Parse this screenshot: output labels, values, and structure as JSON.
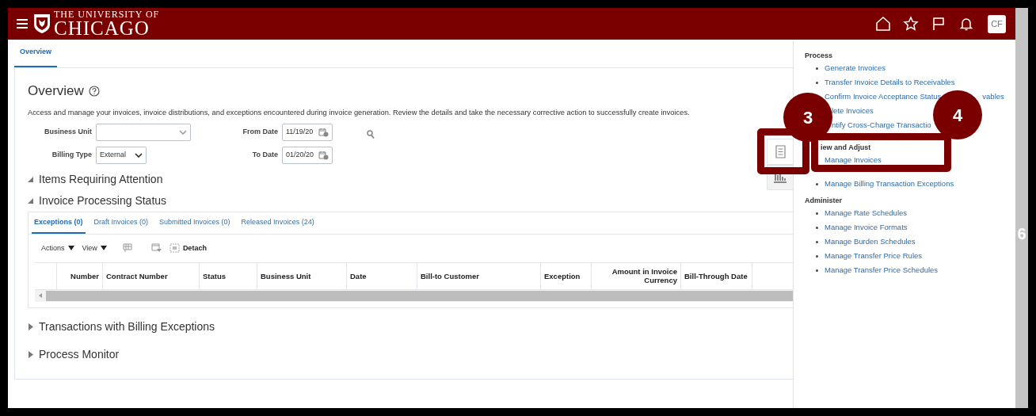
{
  "header": {
    "logo_top": "THE UNIVERSITY OF",
    "logo_main": "CHICAGO",
    "avatar": "CF"
  },
  "tabs": [
    {
      "label": "Overview",
      "selected": true
    }
  ],
  "overview": {
    "title": "Overview",
    "description": "Access and manage your invoices, invoice distributions, and exceptions encountered during invoice generation. Review the details and take the necessary corrective action to successfully create invoices.",
    "fields_left": [
      {
        "label": "Business Unit",
        "kind": "select"
      },
      {
        "label": "Billing Type",
        "kind": "select",
        "value": "External"
      }
    ],
    "fields_right": [
      {
        "label": "From Date",
        "kind": "date",
        "value": "11/19/20"
      },
      {
        "label": "To Date",
        "kind": "date",
        "value": "01/20/20"
      }
    ]
  },
  "sections_top": [
    {
      "title": "Items Requiring Attention",
      "expanded": true
    },
    {
      "title": "Invoice Processing Status",
      "expanded": true
    }
  ],
  "status_tabs": [
    {
      "label": "Exceptions (0)",
      "selected": true
    },
    {
      "label": "Draft Invoices (0)",
      "selected": false
    },
    {
      "label": "Submitted Invoices (0)",
      "selected": false
    },
    {
      "label": "Released Invoices (24)",
      "selected": false
    }
  ],
  "toolbar": {
    "menus": [
      "Actions",
      "View"
    ],
    "detach": "Detach"
  },
  "columns": [
    "Number",
    "Contract Number",
    "Status",
    "Business Unit",
    "Date",
    "Bill-to Customer",
    "Exception",
    "Amount in Invoice Currency",
    "Bill-Through Date"
  ],
  "sections_bottom": [
    {
      "title": "Transactions with Billing Exceptions",
      "expanded": false
    },
    {
      "title": "Process Monitor",
      "expanded": false
    }
  ],
  "tasks": [
    {
      "heading": "Process",
      "kind": "plain",
      "items": [
        {
          "label": "Generate Invoices",
          "kind": "link"
        },
        {
          "label": "Transfer Invoice Details to Receivables",
          "kind": "link"
        },
        {
          "label": "Confirm Invoice Acceptance Status",
          "tail": "vables",
          "kind": "link"
        },
        {
          "label": "lete Invoices",
          "kind": "cut"
        },
        {
          "label": "ntify Cross-Charge Transactio",
          "kind": "cut"
        }
      ]
    },
    {
      "heading": "iew and Adjust",
      "kind": "cut",
      "items": [
        {
          "label": "Manage Invoices",
          "kind": "nobullet"
        },
        {
          "label": "Manage Billing Transaction Exceptions",
          "kind": "link"
        }
      ]
    },
    {
      "heading": "Administer",
      "kind": "plain",
      "items": [
        {
          "label": "Manage Rate Schedules",
          "kind": "link"
        },
        {
          "label": "Manage Invoice Formats",
          "kind": "link"
        },
        {
          "label": "Manage Burden Schedules",
          "kind": "link"
        },
        {
          "label": "Manage Transfer Price Rules",
          "kind": "link"
        },
        {
          "label": "Manage Transfer Price Schedules",
          "kind": "link"
        }
      ]
    }
  ],
  "callouts": [
    {
      "label": "3"
    },
    {
      "label": "4"
    }
  ],
  "edge_mark": "6"
}
